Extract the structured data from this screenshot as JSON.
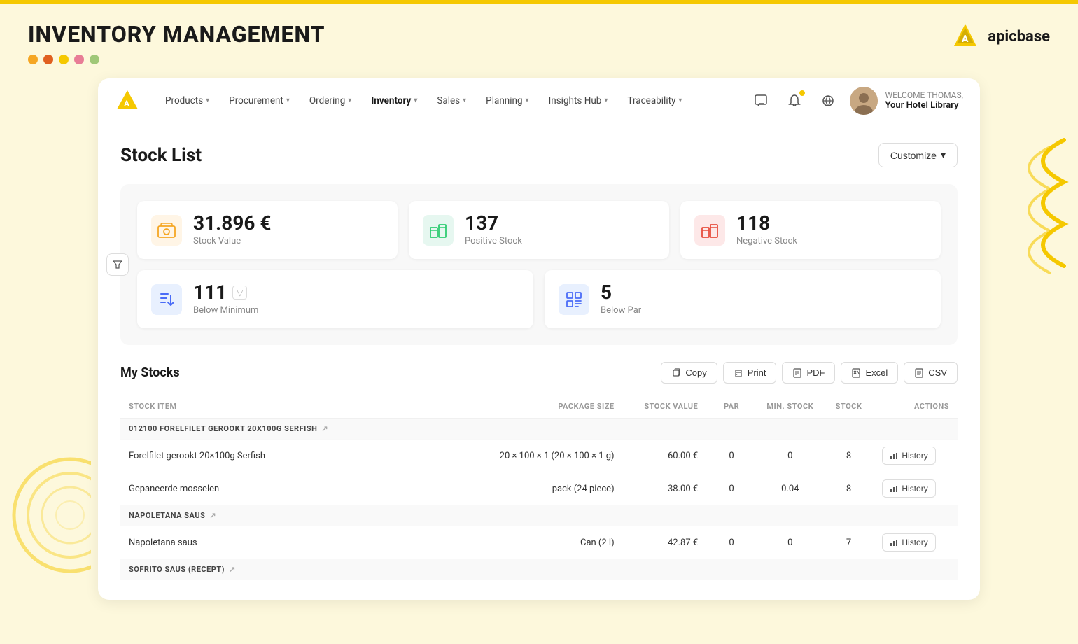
{
  "topBar": {},
  "pageHeader": {
    "title": "INVENTORY MANAGEMENT",
    "dots": [
      "#f5a623",
      "#e8453c",
      "#f5a623",
      "#e8a0b4",
      "#a8d5a2"
    ],
    "logo": {
      "text": "apicbase"
    }
  },
  "navbar": {
    "items": [
      {
        "label": "Products",
        "hasDropdown": true,
        "active": false
      },
      {
        "label": "Procurement",
        "hasDropdown": true,
        "active": false
      },
      {
        "label": "Ordering",
        "hasDropdown": true,
        "active": false
      },
      {
        "label": "Inventory",
        "hasDropdown": true,
        "active": true
      },
      {
        "label": "Sales",
        "hasDropdown": true,
        "active": false
      },
      {
        "label": "Planning",
        "hasDropdown": true,
        "active": false
      },
      {
        "label": "Insights Hub",
        "hasDropdown": true,
        "active": false
      },
      {
        "label": "Traceability",
        "hasDropdown": true,
        "active": false
      }
    ],
    "welcomeText": "WELCOME THOMAS,",
    "hotelName": "Your Hotel Library"
  },
  "content": {
    "pageTitle": "Stock List",
    "customizeLabel": "Customize",
    "stats": {
      "stockValue": {
        "value": "31.896 €",
        "label": "Stock Value"
      },
      "positiveStock": {
        "value": "137",
        "label": "Positive Stock"
      },
      "negativeStock": {
        "value": "118",
        "label": "Negative Stock"
      },
      "belowMinimum": {
        "value": "111",
        "label": "Below Minimum"
      },
      "belowPar": {
        "value": "5",
        "label": "Below Par"
      }
    },
    "myStocks": {
      "title": "My Stocks",
      "actions": [
        "Copy",
        "Print",
        "PDF",
        "Excel",
        "CSV"
      ]
    },
    "table": {
      "headers": [
        "STOCK ITEM",
        "PACKAGE SIZE",
        "STOCK VALUE",
        "PAR",
        "MIN. STOCK",
        "STOCK",
        "ACTIONS"
      ],
      "rows": [
        {
          "type": "category",
          "name": "012100 FORELFILET GEROOKT 20X100G SERFISH",
          "hasLink": true
        },
        {
          "type": "data",
          "name": "Forelfilet gerookt 20×100g Serfish",
          "packageSize": "20 × 100 × 1 (20 × 100 × 1 g)",
          "stockValue": "60.00 €",
          "par": "0",
          "minStock": "0",
          "stock": "8",
          "hasHistory": true
        },
        {
          "type": "data",
          "name": "Gepaneerde mosselen",
          "packageSize": "pack (24 piece)",
          "stockValue": "38.00 €",
          "par": "0",
          "minStock": "0.04",
          "stock": "8",
          "hasHistory": true
        },
        {
          "type": "category",
          "name": "NAPOLETANA SAUS",
          "hasLink": true
        },
        {
          "type": "data",
          "name": "Napoletana saus",
          "packageSize": "Can (2 l)",
          "stockValue": "42.87 €",
          "par": "0",
          "minStock": "0",
          "stock": "7",
          "hasHistory": true
        },
        {
          "type": "category",
          "name": "SOFRITO SAUS (RECEPT)",
          "hasLink": true
        }
      ],
      "historyLabel": "History"
    }
  }
}
